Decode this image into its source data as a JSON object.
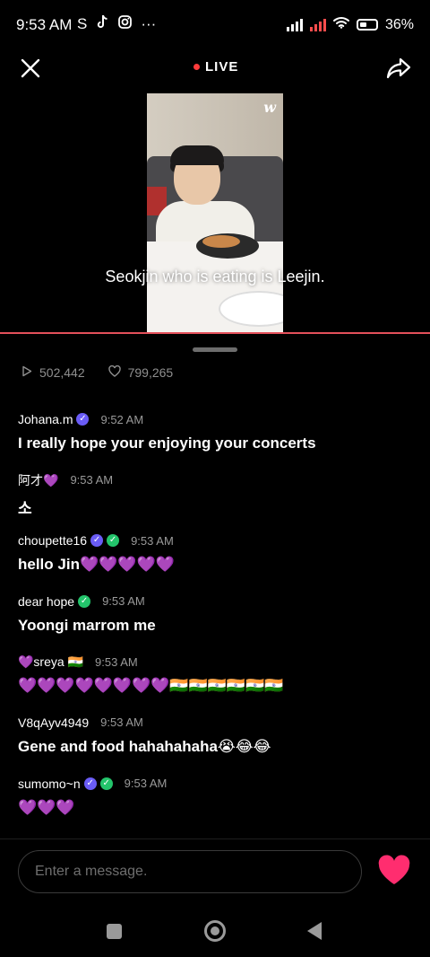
{
  "status_bar": {
    "time": "9:53 AM",
    "left_icons": [
      "S",
      "tiktok-icon",
      "instagram-icon",
      "···"
    ],
    "battery": "36%"
  },
  "header": {
    "live_label": "LIVE",
    "live_color": "#ff3b3b"
  },
  "video": {
    "watermark": "w",
    "subtitle": "Seokjin who is eating is Leejin."
  },
  "stats": {
    "plays": "502,442",
    "likes": "799,265"
  },
  "comments": [
    {
      "user": "Johana.m",
      "badges": [
        "purple"
      ],
      "time": "9:52 AM",
      "text": "I really hope your enjoying your concerts"
    },
    {
      "user": "阿才💜",
      "badges": [],
      "time": "9:53 AM",
      "text": "소"
    },
    {
      "user": "choupette16",
      "badges": [
        "purple",
        "green"
      ],
      "time": "9:53 AM",
      "text": "hello Jin💜💜💜💜💜"
    },
    {
      "user": "dear hope",
      "badges": [
        "green"
      ],
      "time": "9:53 AM",
      "text": "Yoongi marrom me"
    },
    {
      "user": "💜sreya 🇮🇳",
      "badges": [],
      "time": "9:53 AM",
      "text": "💜💜💜💜💜💜💜💜🇮🇳🇮🇳🇮🇳🇮🇳🇮🇳🇮🇳"
    },
    {
      "user": "V8qAyv4949",
      "badges": [],
      "time": "9:53 AM",
      "text": "Gene and food hahahahaha😭😂😂"
    },
    {
      "user": "sumomo~n",
      "badges": [
        "purple",
        "green"
      ],
      "time": "9:53 AM",
      "text": "💜💜💜"
    }
  ],
  "composer": {
    "placeholder": "Enter a message."
  },
  "colors": {
    "progress": "#e3505a",
    "heart": "#ff2d6f",
    "badge_purple": "#6a5cf6",
    "badge_green": "#23c46b"
  }
}
